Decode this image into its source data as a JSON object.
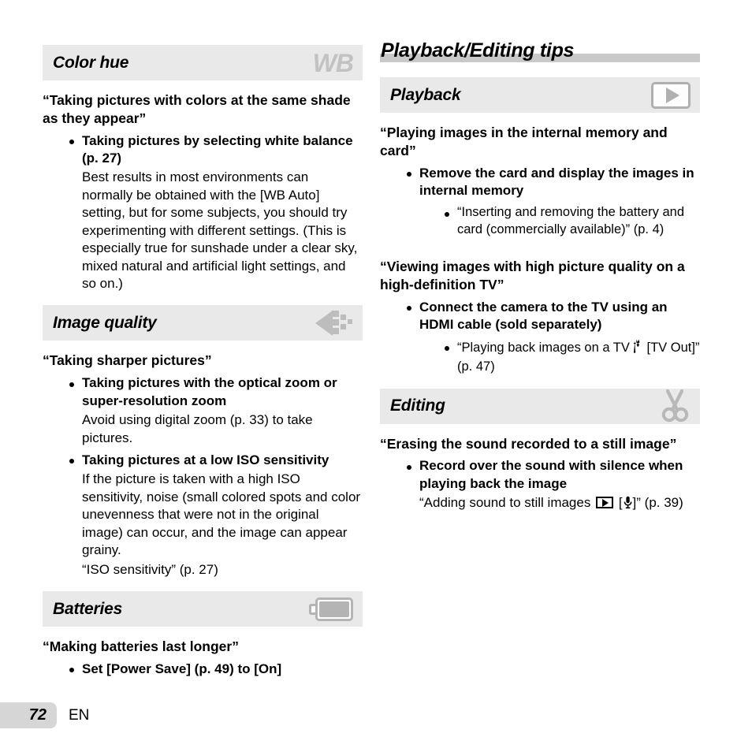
{
  "page": {
    "number": "72",
    "language": "EN"
  },
  "left_column": {
    "sections": [
      {
        "title": "Color hue",
        "icon": "white-balance-wb-icon",
        "blocks": [
          {
            "type": "quote",
            "text": "“Taking pictures with colors at the same shade as they appear”"
          },
          {
            "type": "level1",
            "text": "Taking pictures by selecting white balance (p. 27)"
          },
          {
            "type": "level1-body",
            "text": "Best results in most environments can normally be obtained with the [WB Auto] setting, but for some subjects, you should try experimenting with different settings. (This is especially true for sunshade under a clear sky, mixed natural and artificial light settings, and so on.)"
          }
        ]
      },
      {
        "title": "Image quality",
        "icon": "image-size-arrow-icon",
        "blocks": [
          {
            "type": "quote",
            "text": "“Taking sharper pictures”"
          },
          {
            "type": "level1",
            "text": "Taking pictures with the optical zoom or super-resolution zoom"
          },
          {
            "type": "level1-body",
            "text": "Avoid using digital zoom (p. 33) to take pictures."
          },
          {
            "type": "level1",
            "text": "Taking pictures at a low ISO sensitivity"
          },
          {
            "type": "level1-body",
            "text": "If the picture is taken with a high ISO sensitivity, noise (small colored spots and color unevenness that were not in the original image) can occur, and the image can appear grainy."
          },
          {
            "type": "level1-body",
            "text": "“ISO sensitivity” (p. 27)"
          }
        ]
      },
      {
        "title": "Batteries",
        "icon": "battery-icon",
        "blocks": [
          {
            "type": "quote",
            "text": "“Making batteries last longer”"
          },
          {
            "type": "level1",
            "text": "Set [Power Save] (p. 49) to [On]"
          }
        ]
      }
    ]
  },
  "right_column": {
    "page_title": "Playback/Editing tips",
    "sections": [
      {
        "title": "Playback",
        "icon": "playback-play-icon",
        "blocks": [
          {
            "type": "quote",
            "text": "“Playing images in the internal memory and card”"
          },
          {
            "type": "level1",
            "text": "Remove the card and display the images in internal memory"
          },
          {
            "type": "level2",
            "text": "“Inserting and removing the battery and card (commercially available)” (p. 4)"
          },
          {
            "type": "quote",
            "text": "“Viewing images with high picture quality on a high-definition TV”"
          },
          {
            "type": "level1",
            "text": "Connect the camera to the TV using an HDMI cable (sold separately)"
          },
          {
            "type": "level2-tvout",
            "text_before": "“Playing back images on a TV",
            "text_after": "[TV Out]” (p. 47)",
            "icon": "settings-wrench-icon"
          }
        ]
      },
      {
        "title": "Editing",
        "icon": "scissors-icon",
        "blocks": [
          {
            "type": "quote",
            "text": "“Erasing the sound recorded to a still image”"
          },
          {
            "type": "level1",
            "text": "Record over the sound with silence when playing back the image"
          },
          {
            "type": "level1-sound",
            "text_before": "“Adding sound to still images",
            "text_mid": "[",
            "text_after": "]” (p. 39)",
            "icon_play": "play-box-icon",
            "icon_mic": "microphone-icon"
          }
        ]
      }
    ]
  },
  "colors": {
    "band_background": "#e9e9e9",
    "icon_gray": "#b8b8b8",
    "rule_gray": "#c9c9c9",
    "footer_tab": "#d6d6d6"
  }
}
